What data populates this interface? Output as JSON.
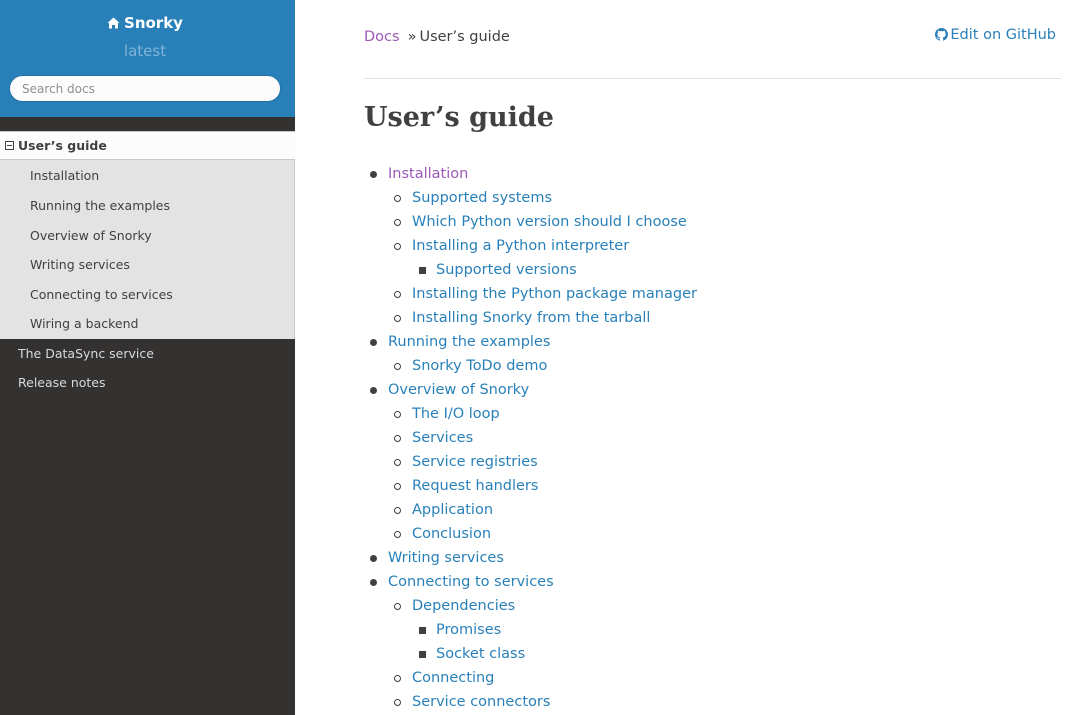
{
  "sidebar": {
    "project_name": "Snorky",
    "version": "latest",
    "search_placeholder": "Search docs",
    "current_section": "User’s guide",
    "current_subitems": [
      "Installation",
      "Running the examples",
      "Overview of Snorky",
      "Writing services",
      "Connecting to services",
      "Wiring a backend"
    ],
    "top_items": [
      "The DataSync service",
      "Release notes"
    ]
  },
  "breadcrumbs": {
    "docs": "Docs",
    "separator": "»",
    "current": "User’s guide"
  },
  "edit_link": "Edit on GitHub",
  "page_title": "User’s guide",
  "toc": [
    {
      "text": "Installation",
      "level": 0,
      "visited": true
    },
    {
      "text": "Supported systems",
      "level": 1
    },
    {
      "text": "Which Python version should I choose",
      "level": 1
    },
    {
      "text": "Installing a Python interpreter",
      "level": 1
    },
    {
      "text": "Supported versions",
      "level": 2
    },
    {
      "text": "Installing the Python package manager",
      "level": 1
    },
    {
      "text": "Installing Snorky from the tarball",
      "level": 1
    },
    {
      "text": "Running the examples",
      "level": 0
    },
    {
      "text": "Snorky ToDo demo",
      "level": 1
    },
    {
      "text": "Overview of Snorky",
      "level": 0
    },
    {
      "text": "The I/O loop",
      "level": 1
    },
    {
      "text": "Services",
      "level": 1
    },
    {
      "text": "Service registries",
      "level": 1
    },
    {
      "text": "Request handlers",
      "level": 1
    },
    {
      "text": "Application",
      "level": 1
    },
    {
      "text": "Conclusion",
      "level": 1
    },
    {
      "text": "Writing services",
      "level": 0
    },
    {
      "text": "Connecting to services",
      "level": 0
    },
    {
      "text": "Dependencies",
      "level": 1
    },
    {
      "text": "Promises",
      "level": 2
    },
    {
      "text": "Socket class",
      "level": 2
    },
    {
      "text": "Connecting",
      "level": 1
    },
    {
      "text": "Service connectors",
      "level": 1
    }
  ],
  "colors": {
    "sidebar_bg": "#343131",
    "sidebar_header": "#2980b9",
    "link": "#2980b9",
    "visited_link": "#9b59b6",
    "text": "#404040"
  }
}
